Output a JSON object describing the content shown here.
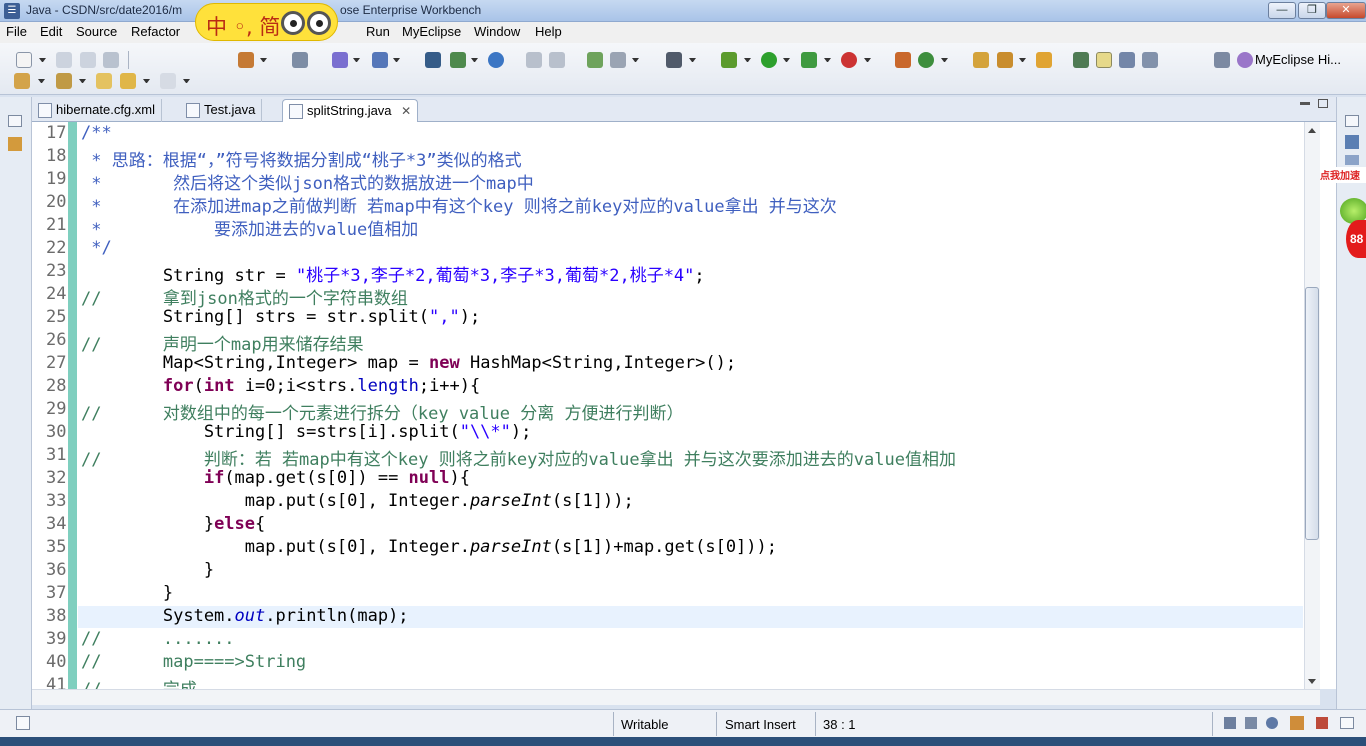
{
  "window": {
    "title_left": "Java - CSDN/src/date2016/m",
    "title_right": "ose Enterprise Workbench",
    "min": "—",
    "restore": "❐",
    "close": "✕"
  },
  "ime": {
    "text": "中 ◦, 简"
  },
  "menu": [
    "File",
    "Edit",
    "Source",
    "Refactor",
    "Run",
    "MyEclipse",
    "Window",
    "Help"
  ],
  "toolbar": {
    "perspective": "MyEclipse Hi..."
  },
  "tabs": [
    {
      "label": "hibernate.cfg.xml",
      "active": false
    },
    {
      "label": "Test.java",
      "active": false
    },
    {
      "label": "splitString.java",
      "active": true,
      "close": "✕"
    }
  ],
  "editor": {
    "current_line": 38,
    "lines": [
      {
        "n": "17",
        "parts": [
          {
            "c": "cm",
            "t": "/**"
          }
        ]
      },
      {
        "n": "18",
        "parts": [
          {
            "c": "cm",
            "t": " * 思路：根据“，”符号将数据分割成“桃子*3”类似的格式"
          }
        ]
      },
      {
        "n": "19",
        "parts": [
          {
            "c": "cm",
            "t": " *       然后将这个类似json格式的数据放进一个map中"
          }
        ]
      },
      {
        "n": "20",
        "parts": [
          {
            "c": "cm",
            "t": " *       在添加进map之前做判断 若map中有这个key 则将之前key对应的value拿出 并与这次"
          }
        ]
      },
      {
        "n": "21",
        "parts": [
          {
            "c": "cm",
            "t": " *           要添加进去的value值相加"
          }
        ]
      },
      {
        "n": "22",
        "parts": [
          {
            "c": "cm",
            "t": " */"
          }
        ]
      },
      {
        "n": "23",
        "parts": [
          {
            "c": "",
            "t": "        String str = "
          },
          {
            "c": "str",
            "t": "\"桃子*3,李子*2,葡萄*3,李子*3,葡萄*2,桃子*4\""
          },
          {
            "c": "",
            "t": ";"
          }
        ]
      },
      {
        "n": "24",
        "parts": [
          {
            "c": "lc",
            "t": "//      拿到json格式的一个字符串数组"
          }
        ]
      },
      {
        "n": "25",
        "parts": [
          {
            "c": "",
            "t": "        String[] strs = str.split("
          },
          {
            "c": "str",
            "t": "\",\""
          },
          {
            "c": "",
            "t": ");"
          }
        ]
      },
      {
        "n": "26",
        "parts": [
          {
            "c": "lc",
            "t": "//      声明一个map用来储存结果"
          }
        ]
      },
      {
        "n": "27",
        "parts": [
          {
            "c": "",
            "t": "        Map<String,Integer> map = "
          },
          {
            "c": "kw",
            "t": "new"
          },
          {
            "c": "",
            "t": " HashMap<String,Integer>();"
          }
        ]
      },
      {
        "n": "28",
        "parts": [
          {
            "c": "",
            "t": "        "
          },
          {
            "c": "kw",
            "t": "for"
          },
          {
            "c": "",
            "t": "("
          },
          {
            "c": "kw",
            "t": "int"
          },
          {
            "c": "",
            "t": " i=0;i<strs."
          },
          {
            "c": "field",
            "t": "length"
          },
          {
            "c": "",
            "t": ";i++){"
          }
        ]
      },
      {
        "n": "29",
        "parts": [
          {
            "c": "lc",
            "t": "//      对数组中的每一个元素进行拆分（key value 分离 方便进行判断）"
          }
        ]
      },
      {
        "n": "30",
        "parts": [
          {
            "c": "",
            "t": "            String[] s=strs[i].split("
          },
          {
            "c": "str",
            "t": "\"\\\\*\""
          },
          {
            "c": "",
            "t": ");"
          }
        ]
      },
      {
        "n": "31",
        "parts": [
          {
            "c": "lc",
            "t": "//          判断：若 若map中有这个key 则将之前key对应的value拿出 并与这次要添加进去的value值相加"
          }
        ]
      },
      {
        "n": "32",
        "parts": [
          {
            "c": "",
            "t": "            "
          },
          {
            "c": "kw",
            "t": "if"
          },
          {
            "c": "",
            "t": "(map.get(s[0]) == "
          },
          {
            "c": "kw",
            "t": "null"
          },
          {
            "c": "",
            "t": "){"
          }
        ]
      },
      {
        "n": "33",
        "parts": [
          {
            "c": "",
            "t": "                map.put(s[0], Integer."
          },
          {
            "c": "it",
            "t": "parseInt"
          },
          {
            "c": "",
            "t": "(s[1]));"
          }
        ]
      },
      {
        "n": "34",
        "parts": [
          {
            "c": "",
            "t": "            }"
          },
          {
            "c": "kw",
            "t": "else"
          },
          {
            "c": "",
            "t": "{"
          }
        ]
      },
      {
        "n": "35",
        "parts": [
          {
            "c": "",
            "t": "                map.put(s[0], Integer."
          },
          {
            "c": "it",
            "t": "parseInt"
          },
          {
            "c": "",
            "t": "(s[1])+map.get(s[0]));"
          }
        ]
      },
      {
        "n": "36",
        "parts": [
          {
            "c": "",
            "t": "            }"
          }
        ]
      },
      {
        "n": "37",
        "parts": [
          {
            "c": "",
            "t": "        }"
          }
        ]
      },
      {
        "n": "38",
        "parts": [
          {
            "c": "",
            "t": "        System."
          },
          {
            "c": "fld",
            "t": "out"
          },
          {
            "c": "",
            "t": ".println(map);"
          }
        ]
      },
      {
        "n": "39",
        "parts": [
          {
            "c": "lc",
            "t": "//      ......."
          }
        ]
      },
      {
        "n": "40",
        "parts": [
          {
            "c": "lc",
            "t": "//      map====>String"
          }
        ]
      },
      {
        "n": "41",
        "parts": [
          {
            "c": "lc",
            "t": "//      完成"
          }
        ]
      }
    ]
  },
  "status": {
    "writable": "Writable",
    "insert_mode": "Smart Insert",
    "position": "38 : 1"
  },
  "widget": {
    "label": "点我加速",
    "badge": "88"
  }
}
